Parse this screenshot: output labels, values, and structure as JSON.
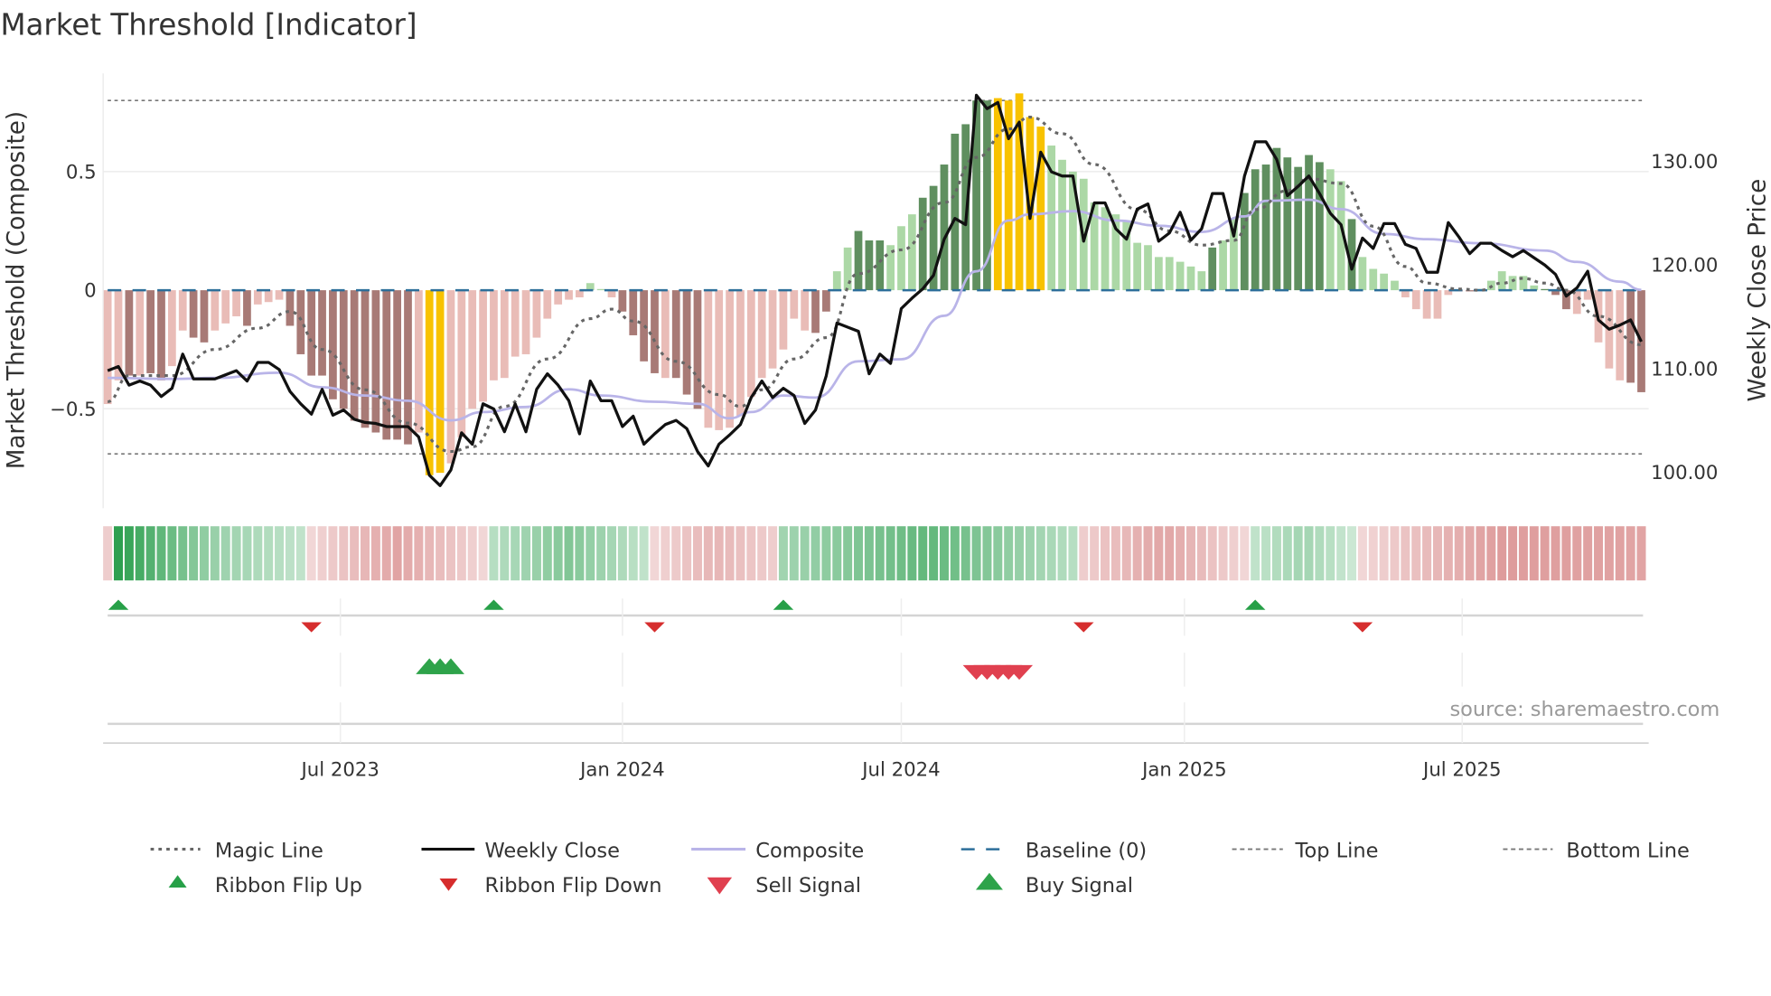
{
  "chart_data": {
    "type": "bar",
    "title": "Market Threshold [Indicator]",
    "ylabel": "Market Threshold (Composite)",
    "ylabel_right": "Weekly Close Price",
    "ylim": [
      -0.92,
      0.91
    ],
    "ylim_right": [
      96.5,
      138.5
    ],
    "left_ticks": [
      {
        "v": 0.5,
        "label": "0.5"
      },
      {
        "v": 0,
        "label": "0"
      },
      {
        "v": -0.5,
        "label": "−0.5"
      }
    ],
    "right_ticks": [
      {
        "v": 130,
        "label": "130.00"
      },
      {
        "v": 120,
        "label": "120.00"
      },
      {
        "v": 110,
        "label": "110.00"
      },
      {
        "v": 100,
        "label": "100.00"
      }
    ],
    "x_ticks": [
      {
        "w": 21.7,
        "label": "Jul 2023"
      },
      {
        "w": 48,
        "label": "Jan 2024"
      },
      {
        "w": 74,
        "label": "Jul 2024"
      },
      {
        "w": 100.4,
        "label": "Jan 2025"
      },
      {
        "w": 126.3,
        "label": "Jul 2025"
      }
    ],
    "top_line": 0.8,
    "bottom_line": -0.69,
    "baseline": 0,
    "colors": {
      "bar_dark_pos": "#5f8f5f",
      "bar_light_pos": "#acd8a6",
      "bar_dark_neg": "#a87a76",
      "bar_light_neg": "#e9bcb7",
      "bar_extreme": "#f8c200",
      "close": "#111111",
      "composite": "#b9b4e8",
      "magic": "#666666",
      "baseline": "#2d6f9a",
      "up": "#27a048",
      "down": "#d62d2d",
      "sell": "#e0404f"
    },
    "composite_bars": [
      -0.48,
      -0.38,
      -0.36,
      -0.36,
      -0.35,
      -0.38,
      -0.32,
      -0.17,
      -0.2,
      -0.22,
      -0.17,
      -0.14,
      -0.11,
      -0.15,
      -0.06,
      -0.05,
      -0.04,
      -0.15,
      -0.27,
      -0.36,
      -0.36,
      -0.46,
      -0.5,
      -0.55,
      -0.58,
      -0.6,
      -0.63,
      -0.63,
      -0.65,
      -0.6,
      -0.78,
      -0.77,
      -0.73,
      -0.62,
      -0.5,
      -0.47,
      -0.38,
      -0.37,
      -0.28,
      -0.27,
      -0.2,
      -0.12,
      -0.06,
      -0.04,
      -0.03,
      0.03,
      0.005,
      -0.03,
      -0.09,
      -0.19,
      -0.3,
      -0.35,
      -0.37,
      -0.37,
      -0.44,
      -0.5,
      -0.58,
      -0.59,
      -0.58,
      -0.53,
      -0.45,
      -0.37,
      -0.33,
      -0.25,
      -0.12,
      -0.17,
      -0.18,
      -0.09,
      0.08,
      0.18,
      0.25,
      0.21,
      0.21,
      0.19,
      0.27,
      0.32,
      0.39,
      0.44,
      0.53,
      0.66,
      0.7,
      0.8,
      0.8,
      0.81,
      0.8,
      0.83,
      0.73,
      0.69,
      0.61,
      0.55,
      0.5,
      0.47,
      0.37,
      0.35,
      0.32,
      0.29,
      0.2,
      0.19,
      0.14,
      0.14,
      0.12,
      0.1,
      0.08,
      0.18,
      0.21,
      0.3,
      0.41,
      0.51,
      0.53,
      0.6,
      0.56,
      0.52,
      0.57,
      0.54,
      0.51,
      0.46,
      0.3,
      0.14,
      0.09,
      0.07,
      0.04,
      -0.03,
      -0.08,
      -0.12,
      -0.12,
      -0.02,
      -0.005,
      -0.005,
      0.005,
      0.04,
      0.08,
      0.06,
      0.06,
      0.02,
      0.005,
      -0.02,
      -0.08,
      -0.1,
      -0.04,
      -0.22,
      -0.33,
      -0.38,
      -0.39,
      -0.43
    ],
    "bar_styles": "lldlddllddllldlllddddddddddddlyyllllllllllllllllddddldddllllllllllddlldd dllldddddddyyyyyllllllllllllllldllddddddddlldllllllllllddllllldddlllllddlddddd",
    "weekly_close": [
      109.8,
      110.2,
      108.4,
      108.8,
      108.4,
      107.3,
      108.1,
      111.4,
      109.0,
      109.0,
      109.0,
      109.4,
      109.8,
      108.8,
      110.6,
      110.6,
      109.9,
      107.8,
      106.6,
      105.6,
      108.0,
      105.5,
      106.0,
      105.1,
      104.8,
      104.7,
      104.4,
      104.4,
      104.4,
      103.4,
      99.7,
      98.7,
      100.2,
      103.8,
      102.7,
      106.6,
      106.1,
      103.9,
      106.6,
      103.9,
      108.0,
      109.5,
      108.4,
      106.9,
      103.7,
      108.8,
      106.9,
      106.9,
      104.4,
      105.4,
      102.7,
      103.7,
      104.6,
      105.0,
      104.2,
      102.0,
      100.6,
      102.7,
      103.6,
      104.6,
      107.2,
      108.8,
      107.2,
      108.1,
      107.4,
      104.7,
      106.0,
      109.3,
      114.4,
      114.0,
      113.6,
      109.5,
      111.4,
      110.5,
      115.8,
      116.8,
      117.7,
      119.0,
      122.5,
      124.5,
      123.9,
      136.4,
      135.1,
      135.7,
      132.2,
      133.8,
      124.5,
      130.9,
      129.0,
      128.6,
      128.6,
      122.3,
      126.0,
      126.0,
      123.5,
      122.5,
      125.4,
      125.9,
      122.3,
      123.1,
      125.1,
      122.4,
      123.5,
      126.9,
      126.9,
      122.8,
      128.6,
      131.9,
      131.9,
      130.2,
      126.7,
      127.6,
      128.6,
      126.9,
      125.0,
      123.9,
      119.6,
      122.6,
      121.6,
      124.0,
      124.0,
      122.0,
      121.6,
      119.3,
      119.3,
      124.1,
      122.7,
      121.1,
      122.1,
      122.1,
      121.4,
      120.8,
      121.4,
      120.7,
      120.0,
      119.1,
      117.0,
      117.8,
      119.4,
      114.7,
      113.8,
      114.2,
      114.7,
      112.6
    ],
    "magic_line": [
      [
        0,
        -0.47
      ],
      [
        2,
        -0.36
      ],
      [
        6,
        -0.36
      ],
      [
        10,
        -0.25
      ],
      [
        14,
        -0.16
      ],
      [
        17,
        -0.09
      ],
      [
        20,
        -0.25
      ],
      [
        24,
        -0.42
      ],
      [
        28,
        -0.56
      ],
      [
        32,
        -0.68
      ],
      [
        34,
        -0.66
      ],
      [
        37,
        -0.49
      ],
      [
        41,
        -0.29
      ],
      [
        45,
        -0.12
      ],
      [
        47,
        -0.08
      ],
      [
        49,
        -0.13
      ],
      [
        53,
        -0.3
      ],
      [
        57,
        -0.44
      ],
      [
        59,
        -0.49
      ],
      [
        61,
        -0.42
      ],
      [
        64,
        -0.29
      ],
      [
        67,
        -0.2
      ],
      [
        70,
        0.07
      ],
      [
        74,
        0.17
      ],
      [
        78,
        0.37
      ],
      [
        81,
        0.56
      ],
      [
        84,
        0.68
      ],
      [
        86,
        0.73
      ],
      [
        89,
        0.66
      ],
      [
        92,
        0.53
      ],
      [
        96,
        0.34
      ],
      [
        99,
        0.25
      ],
      [
        102,
        0.19
      ],
      [
        105,
        0.21
      ],
      [
        107,
        0.34
      ],
      [
        110,
        0.42
      ],
      [
        112,
        0.47
      ],
      [
        115,
        0.45
      ],
      [
        118,
        0.27
      ],
      [
        121,
        0.1
      ],
      [
        123,
        0.03
      ],
      [
        126,
        0.005
      ],
      [
        128,
        0
      ],
      [
        130,
        0.03
      ],
      [
        132,
        0.05
      ],
      [
        134,
        0.03
      ],
      [
        136,
        0
      ],
      [
        139,
        -0.11
      ],
      [
        143,
        -0.23
      ]
    ],
    "composite_line": [
      [
        0,
        109.1
      ],
      [
        6,
        109.0
      ],
      [
        10,
        109.1
      ],
      [
        16,
        109.6
      ],
      [
        20,
        108.2
      ],
      [
        24,
        107.4
      ],
      [
        28,
        106.9
      ],
      [
        32,
        105.0
      ],
      [
        35,
        105.8
      ],
      [
        39,
        106.3
      ],
      [
        43,
        108.0
      ],
      [
        46,
        107.4
      ],
      [
        51,
        106.8
      ],
      [
        55,
        106.6
      ],
      [
        58,
        105.2
      ],
      [
        60,
        105.8
      ],
      [
        63,
        107.4
      ],
      [
        66,
        107.2
      ],
      [
        70,
        110.7
      ],
      [
        74,
        110.9
      ],
      [
        78,
        115.1
      ],
      [
        81,
        119.4
      ],
      [
        84,
        124.3
      ],
      [
        86,
        124.9
      ],
      [
        90,
        125.2
      ],
      [
        94,
        124.3
      ],
      [
        98,
        123.8
      ],
      [
        102,
        123.2
      ],
      [
        106,
        124.7
      ],
      [
        108,
        126.2
      ],
      [
        112,
        126.3
      ],
      [
        115,
        125.4
      ],
      [
        119,
        123.0
      ],
      [
        123,
        122.5
      ],
      [
        128,
        122.1
      ],
      [
        134,
        121.4
      ],
      [
        137,
        120.3
      ],
      [
        141,
        118.4
      ],
      [
        143,
        117.6
      ]
    ],
    "ribbon": [
      {
        "start": 0,
        "end": 0,
        "dir": "down",
        "s": [
          0.3,
          0.3,
          0.3
        ]
      },
      {
        "start": 1,
        "end": 18,
        "dir": "up",
        "s": [
          1.0,
          0.5,
          0.3
        ]
      },
      {
        "start": 19,
        "end": 35,
        "dir": "down",
        "s": [
          0.25,
          0.55,
          0.25
        ]
      },
      {
        "start": 36,
        "end": 50,
        "dir": "up",
        "s": [
          0.35,
          0.6,
          0.3
        ]
      },
      {
        "start": 51,
        "end": 62,
        "dir": "down",
        "s": [
          0.25,
          0.45,
          0.3
        ]
      },
      {
        "start": 63,
        "end": 90,
        "dir": "up",
        "s": [
          0.45,
          0.75,
          0.35
        ]
      },
      {
        "start": 91,
        "end": 106,
        "dir": "down",
        "s": [
          0.3,
          0.55,
          0.25
        ]
      },
      {
        "start": 107,
        "end": 116,
        "dir": "up",
        "s": [
          0.3,
          0.45,
          0.25
        ]
      },
      {
        "start": 117,
        "end": 143,
        "dir": "down",
        "s": [
          0.25,
          0.6,
          0.55
        ]
      }
    ],
    "ribbon_flip_up": [
      1,
      36,
      63,
      107
    ],
    "ribbon_flip_down": [
      19,
      51,
      91,
      117
    ],
    "buy_signals": [
      30,
      31,
      32
    ],
    "sell_signals": [
      81,
      82,
      83,
      84,
      85
    ]
  },
  "source": "source: sharemaestro.com",
  "legend": {
    "magic": "Magic Line",
    "close": "Weekly Close",
    "composite": "Composite",
    "baseline": "Baseline (0)",
    "top": "Top Line",
    "bottom": "Bottom Line",
    "flip_up": "Ribbon Flip Up",
    "flip_down": "Ribbon Flip Down",
    "sell": "Sell Signal",
    "buy": "Buy Signal"
  }
}
